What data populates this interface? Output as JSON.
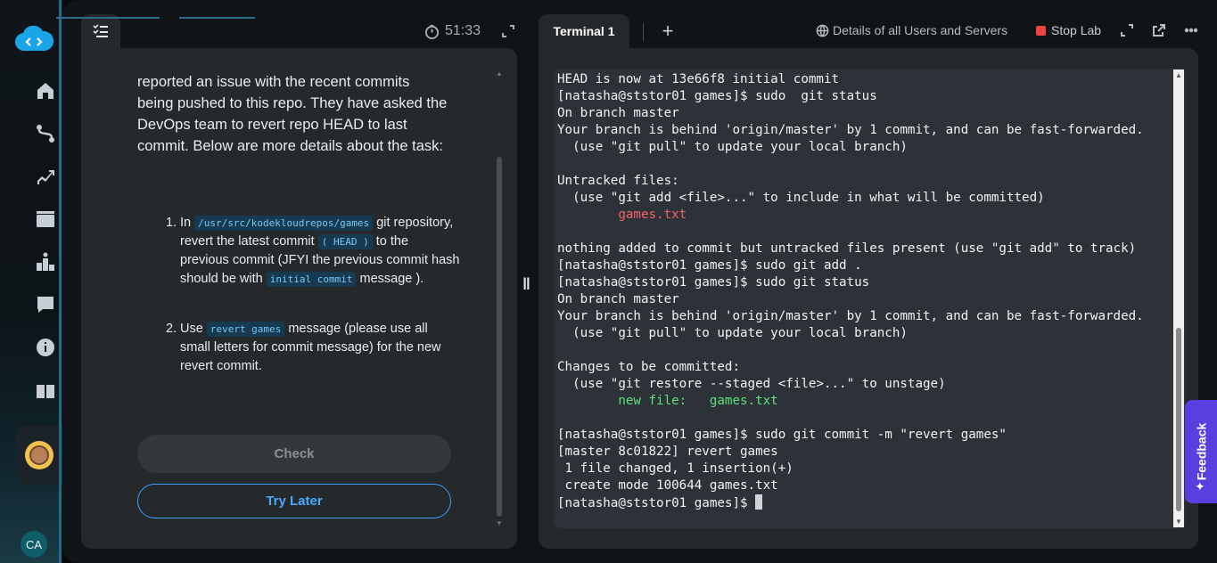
{
  "rail": {
    "icons": [
      "kodekloud-logo-icon",
      "home-icon",
      "learning-path-icon",
      "progress-icon",
      "playground-icon",
      "leaderboard-icon",
      "notes-icon",
      "info-icon",
      "book-icon"
    ],
    "user_initials": "CA"
  },
  "task": {
    "timer": "51:33",
    "intro_text": "reported an issue with the recent commits being pushed to this repo. They have asked the DevOps team to revert repo HEAD to last commit. Below are more details about the task:",
    "steps": [
      {
        "num": "1.",
        "t1": "In",
        "code1": "/usr/src/kodekloudrepos/games",
        "t2": "git repository, revert the latest commit",
        "code2": "( HEAD )",
        "t3": "to the previous commit (JFYI the previous commit hash should be with",
        "code3": "initial commit",
        "t4": "message )."
      },
      {
        "num": "2.",
        "t1": "Use",
        "code1": "revert games",
        "t2": "message (please use all small letters for commit message) for the new revert commit."
      }
    ],
    "check_label": "Check",
    "try_later_label": "Try Later"
  },
  "terminal": {
    "tab_label": "Terminal 1",
    "add_tab": "+",
    "users_link": "Details of all Users and Servers",
    "stop_lab": "Stop Lab",
    "lines": [
      "HEAD is now at 13e66f8 initial commit",
      "[natasha@ststor01 games]$ sudo  git status",
      "On branch master",
      "Your branch is behind 'origin/master' by 1 commit, and can be fast-forwarded.",
      "  (use \"git pull\" to update your local branch)",
      "",
      "Untracked files:",
      "  (use \"git add <file>...\" to include in what will be committed)",
      "        games.txt",
      "",
      "nothing added to commit but untracked files present (use \"git add\" to track)",
      "[natasha@ststor01 games]$ sudo git add .",
      "[natasha@ststor01 games]$ sudo git status",
      "On branch master",
      "Your branch is behind 'origin/master' by 1 commit, and can be fast-forwarded.",
      "  (use \"git pull\" to update your local branch)",
      "",
      "Changes to be committed:",
      "  (use \"git restore --staged <file>...\" to unstage)",
      "        new file:   games.txt",
      "",
      "[natasha@ststor01 games]$ sudo git commit -m \"revert games\"",
      "[master 8c01822] revert games",
      " 1 file changed, 1 insertion(+)",
      " create mode 100644 games.txt",
      "[natasha@ststor01 games]$ "
    ],
    "line_colors": {
      "8": "red",
      "19": "green"
    }
  },
  "feedback": {
    "label": "Feedback"
  },
  "colors": {
    "accent": "#3ba0ff",
    "feedback": "#5b3ee0",
    "stop": "#ef4444",
    "untracked": "#f06464",
    "staged": "#5ee07a"
  }
}
